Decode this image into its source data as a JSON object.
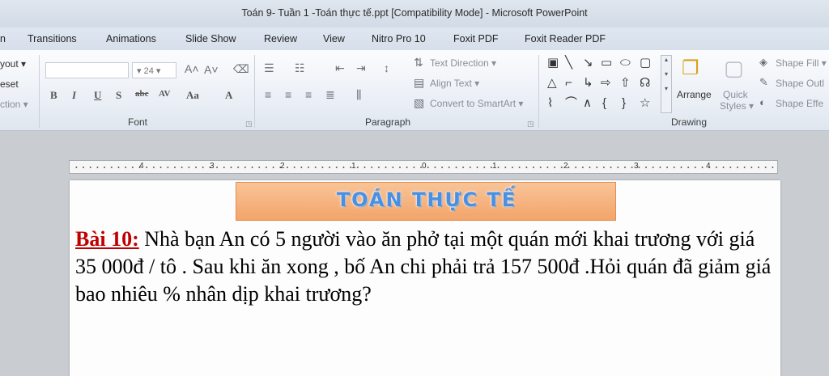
{
  "window": {
    "title": "Toán 9- Tuần 1 -Toán thực tế.ppt [Compatibility Mode]  -  Microsoft PowerPoint"
  },
  "tabs": [
    {
      "label": "n"
    },
    {
      "label": "Transitions"
    },
    {
      "label": "Animations"
    },
    {
      "label": "Slide Show"
    },
    {
      "label": "Review"
    },
    {
      "label": "View"
    },
    {
      "label": "Nitro Pro 10"
    },
    {
      "label": "Foxit PDF"
    },
    {
      "label": "Foxit Reader PDF"
    }
  ],
  "ribbon": {
    "slides_group": {
      "layout": "yout ▾",
      "reset": "eset",
      "section": "ction ▾"
    },
    "font": {
      "size": "24",
      "group_label": "Font"
    },
    "paragraph": {
      "text_direction": "Text Direction ▾",
      "align_text": "Align Text ▾",
      "convert_smartart": "Convert to SmartArt ▾",
      "group_label": "Paragraph"
    },
    "drawing": {
      "arrange": "Arrange",
      "quick_styles_1": "Quick",
      "quick_styles_2": "Styles ▾",
      "shape_fill": "Shape Fill ▾",
      "shape_outline": "Shape Outl",
      "shape_effects": "Shape Effe",
      "group_label": "Drawing"
    }
  },
  "ruler": {
    "labels": [
      "4",
      "3",
      "2",
      "1",
      "0",
      "1",
      "2",
      "3",
      "4"
    ]
  },
  "slide": {
    "banner": "TOÁN THỰC TẾ",
    "problem_label": "Bài 10:",
    "problem_text": " Nhà bạn An có 5 người vào ăn phở tại một quán mới khai trương với giá 35 000đ / tô . Sau khi ăn xong , bố An chi phải trả 157 500đ .Hỏi quán đã giảm giá bao nhiêu % nhân dịp khai trương?"
  }
}
